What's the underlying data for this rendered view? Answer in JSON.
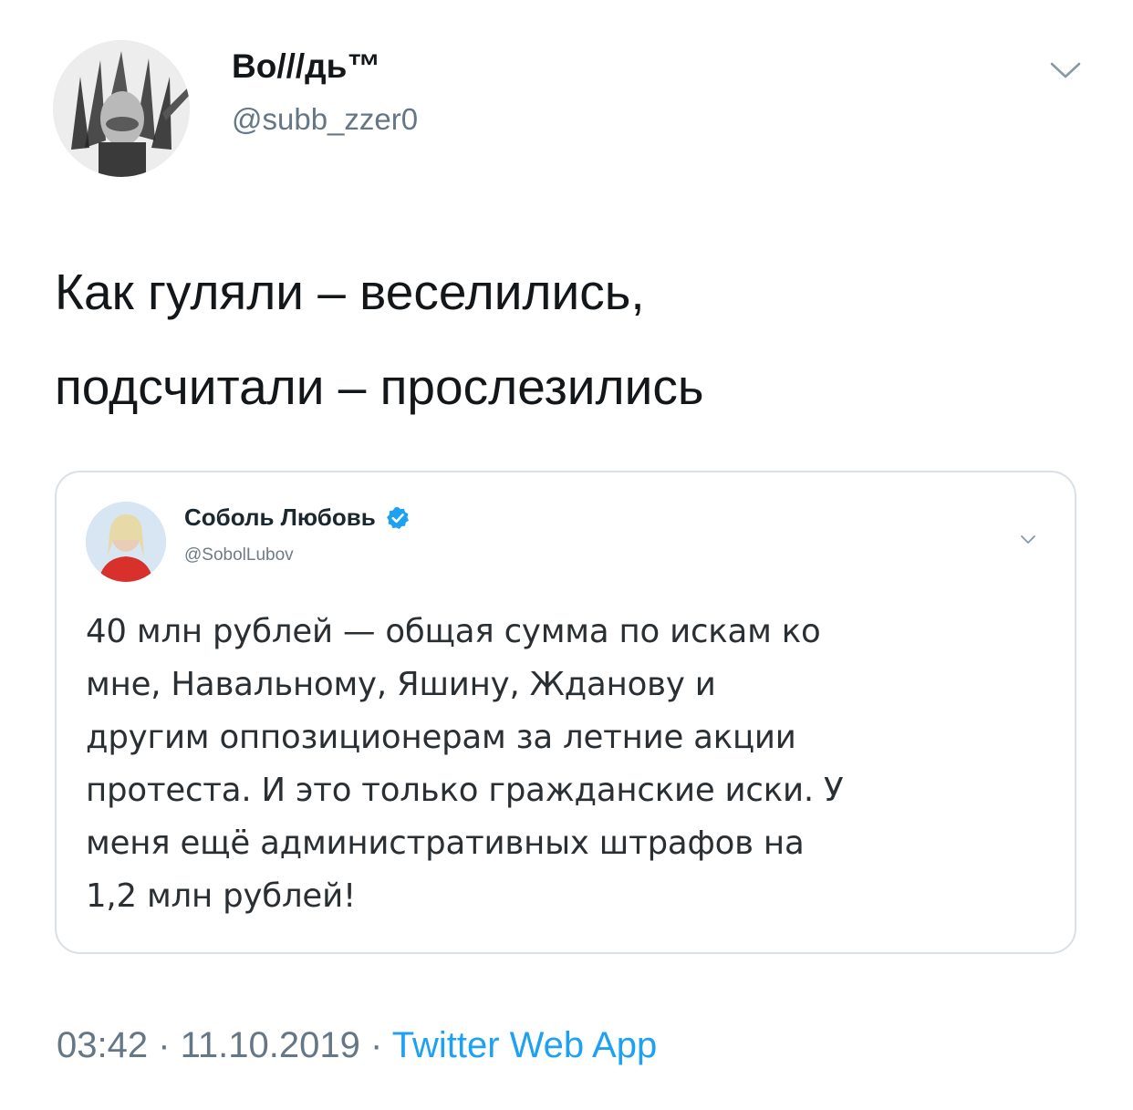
{
  "author": {
    "display_name": "Bo///дь™",
    "handle": "@subb_zzer0",
    "avatar_icon": "avatar-portrait"
  },
  "tweet": {
    "lines": [
      "Как гуляли – веселились,",
      "подсчитали – прослезились"
    ]
  },
  "quoted": {
    "display_name": "Соболь Любовь",
    "handle": "@SobolLubov",
    "verified": true,
    "avatar_icon": "avatar-portrait",
    "lines": [
      "40 млн рублей — общая сумма по искам ко",
      "мне, Навальному, Яшину, Жданову и",
      "другим оппозиционерам за летние акции",
      "протеста. И это только гражданские иски. У",
      "меня ещё административных штрафов на",
      "1,2 млн рублей!"
    ]
  },
  "meta": {
    "time": "03:42",
    "sep1": " · ",
    "date": "11.10.2019",
    "sep2": " · ",
    "app": "Twitter Web App"
  },
  "colors": {
    "accent": "#1da1f2",
    "text": "#14171a",
    "secondary": "#657786",
    "border": "#d9e0e6"
  }
}
